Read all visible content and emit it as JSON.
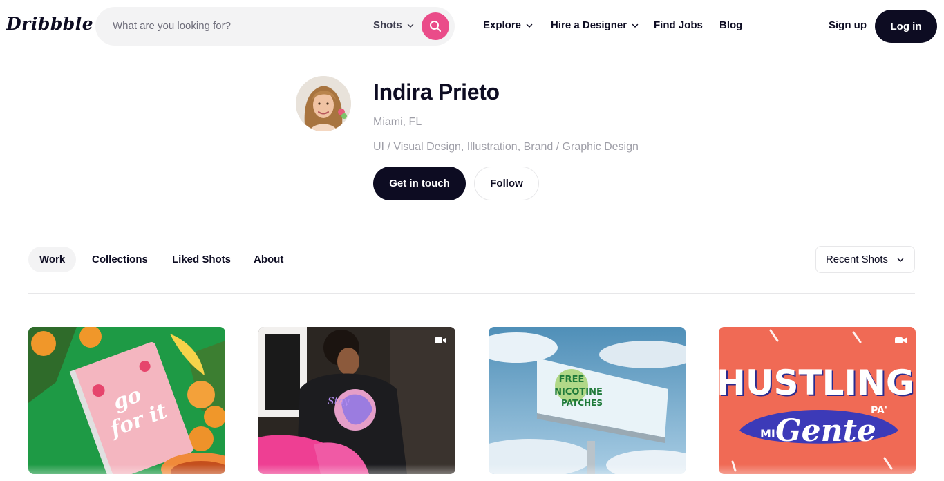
{
  "header": {
    "logo": "Dribbble",
    "search": {
      "placeholder": "What are you looking for?",
      "type_selected": "Shots"
    },
    "nav": {
      "explore": "Explore",
      "hire": "Hire a Designer",
      "jobs": "Find Jobs",
      "blog": "Blog"
    },
    "signup": "Sign up",
    "login": "Log in"
  },
  "profile": {
    "name": "Indira Prieto",
    "location": "Miami, FL",
    "skills": "UI / Visual Design, Illustration, Brand / Graphic Design",
    "contact_label": "Get in touch",
    "follow_label": "Follow"
  },
  "tabs": [
    {
      "label": "Work",
      "active": true
    },
    {
      "label": "Collections",
      "active": false
    },
    {
      "label": "Liked Shots",
      "active": false
    },
    {
      "label": "About",
      "active": false
    }
  ],
  "sort": {
    "selected": "Recent Shots"
  },
  "shots": [
    {
      "name": "Go for it planner",
      "has_video": false
    },
    {
      "name": "Sweatshirt illustration",
      "has_video": true
    },
    {
      "name": "Free Nicotine Patches billboard",
      "has_video": false
    },
    {
      "name": "Hustling Pa' Mi Gente lettering",
      "has_video": true
    }
  ],
  "colors": {
    "brand_pink": "#ea4c89",
    "dark": "#0d0c22",
    "muted_text": "#9e9ea7"
  }
}
